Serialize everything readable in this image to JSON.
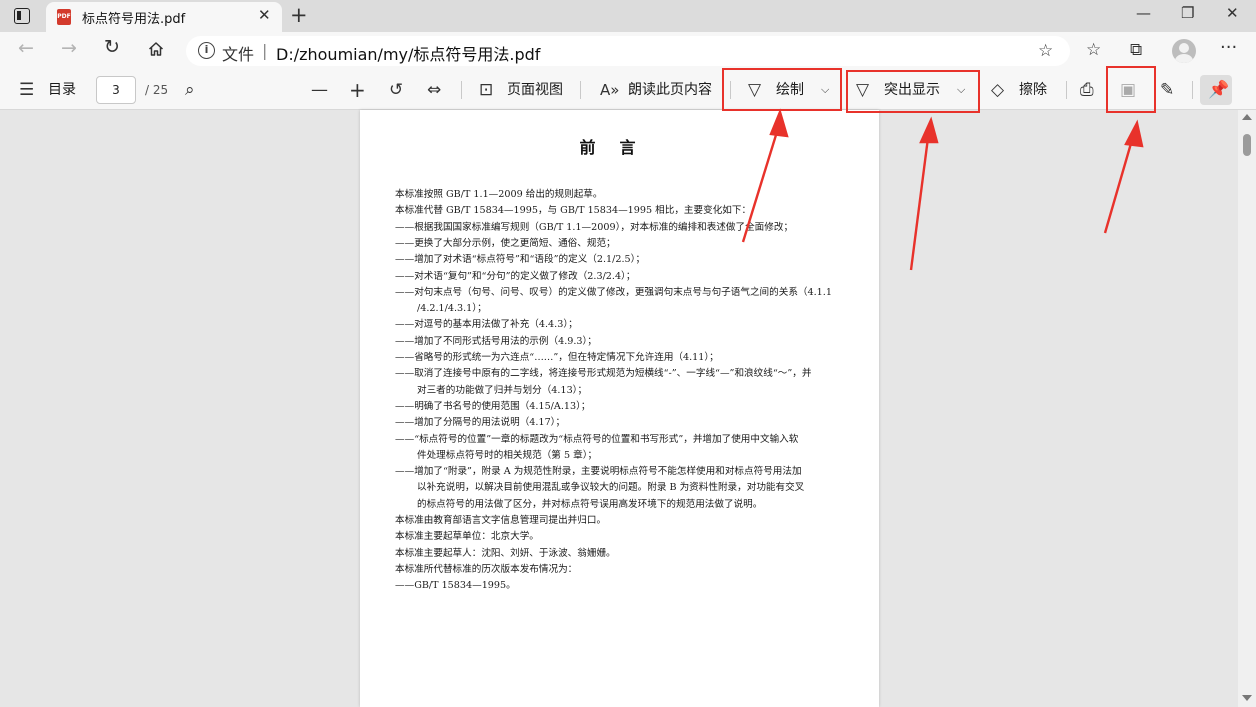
{
  "tab": {
    "title": "标点符号用法.pdf",
    "icon": "pdf-file-icon"
  },
  "window": {
    "minimize": "—",
    "maximize": "❐",
    "close": "✕",
    "new_tab": "+",
    "tab_close": "✕"
  },
  "address": {
    "label": "文件",
    "separator": "|",
    "url": "D:/zhoumian/my/标点符号用法.pdf"
  },
  "pdf_toolbar": {
    "toc_label": "目录",
    "current_page": "3",
    "total_pages": "/ 25",
    "page_view_label": "页面视图",
    "read_aloud_label": "朗读此页内容",
    "draw_label": "绘制",
    "highlight_label": "突出显示",
    "erase_label": "擦除"
  },
  "document": {
    "title": "前言",
    "lines": [
      "本标准按照 GB/T 1.1—2009 给出的规则起草。",
      "本标准代替 GB/T 15834—1995，与 GB/T 15834—1995 相比，主要变化如下：",
      "——根据我国国家标准编写规则（GB/T 1.1—2009），对本标准的编排和表述做了全面修改；",
      "——更换了大部分示例，使之更简短、通俗、规范；",
      "——增加了对术语“标点符号”和“语段”的定义（2.1/2.5）；",
      "——对术语“复句”和“分句”的定义做了修改（2.3/2.4）；",
      "——对句末点号（句号、问号、叹号）的定义做了修改，更强调句末点号与句子语气之间的关系（4.1.1",
      "/4.2.1/4.3.1）；",
      "——对逗号的基本用法做了补充（4.4.3）；",
      "——增加了不同形式括号用法的示例（4.9.3）；",
      "——省略号的形式统一为六连点“……”，但在特定情况下允许连用（4.11）；",
      "——取消了连接号中原有的二字线，将连接号形式规范为短横线“-”、一字线“—”和浪纹线“～”，并",
      "对三者的功能做了归并与划分（4.13）；",
      "——明确了书名号的使用范围（4.15/A.13）；",
      "——增加了分隔号的用法说明（4.17）；",
      "——“标点符号的位置”一章的标题改为“标点符号的位置和书写形式”，并增加了使用中文输入软",
      "件处理标点符号时的相关规范（第 5 章）；",
      "——增加了“附录”，附录 A 为规范性附录，主要说明标点符号不能怎样使用和对标点符号用法加",
      "以补充说明，以解决目前使用混乱或争议较大的问题。附录 B 为资料性附录，对功能有交叉",
      "的标点符号的用法做了区分，并对标点符号误用高发环境下的规范用法做了说明。",
      "本标准由教育部语言文字信息管理司提出并归口。",
      "本标准主要起草单位：北京大学。",
      "本标准主要起草人：沈阳、刘妍、于泳波、翁姗姗。",
      "本标准所代替标准的历次版本发布情况为：",
      "——GB/T 15834—1995。"
    ]
  },
  "annotation_color": "#e8322b"
}
